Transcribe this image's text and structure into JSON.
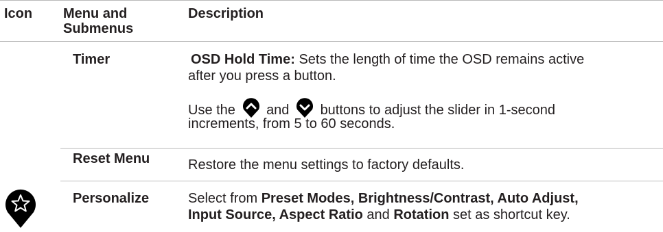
{
  "header": {
    "col_icon": "Icon",
    "col_menu_line1": "Menu and",
    "col_menu_line2": "Submenus",
    "col_desc": "Description"
  },
  "rows": {
    "timer": {
      "menu": "Timer",
      "hold_label": "OSD Hold Time:",
      "hold_text_1": "Sets the length of time the OSD remains active",
      "hold_text_2": "after you press a button.",
      "use_pre": "Use the",
      "use_and": "and",
      "use_post": "buttons to adjust the slider in 1-second",
      "use_line2": "increments, from 5 to 60 seconds."
    },
    "reset": {
      "menu": "Reset Menu",
      "desc": "Restore the menu settings to factory defaults."
    },
    "personalize": {
      "menu": "Personalize",
      "icon": "star-icon",
      "line1_pre": "Select from",
      "line1_bold": "Preset Modes, Brightness/Contrast, Auto Adjust,",
      "line2_bold1": "Input Source, Aspect Ratio",
      "line2_and": "and",
      "line2_bold2": "Rotation",
      "line2_post": "set as shortcut key."
    }
  },
  "icons": {
    "up_button": "chevron-up-icon",
    "down_button": "chevron-down-icon"
  },
  "colors": {
    "text": "#231f20",
    "rule": "#b9b9b9",
    "icon_fill": "#000000"
  }
}
